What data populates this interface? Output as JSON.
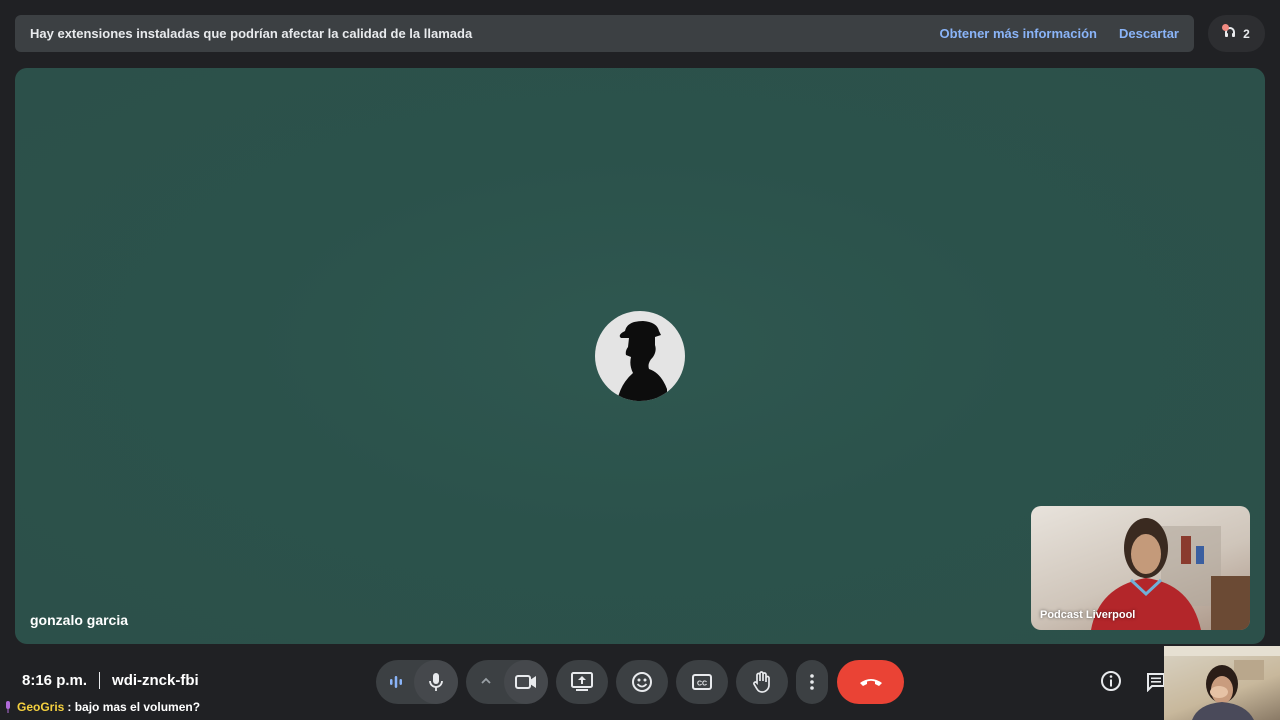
{
  "banner": {
    "message": "Hay extensiones instaladas que podrían afectar la calidad de la llamada",
    "learn_more": "Obtener más información",
    "dismiss": "Descartar"
  },
  "participants": {
    "count": "2"
  },
  "main_tile": {
    "name": "gonzalo garcia"
  },
  "self_tile": {
    "name": "Podcast Liverpool"
  },
  "meeting": {
    "time": "8:16 p.m.",
    "code": "wdi-znck-fbi"
  },
  "chat_overlay": {
    "user": "GeoGris",
    "message": ": bajo mas el volumen?"
  },
  "colors": {
    "hangup": "#ea4335",
    "link": "#8ab4f8",
    "stage": "#2c524b"
  },
  "icons": [
    "speaking-indicator-icon",
    "microphone-icon",
    "chevron-up-icon",
    "camera-icon",
    "present-screen-icon",
    "emoji-icon",
    "captions-icon",
    "raise-hand-icon",
    "more-options-icon",
    "hang-up-icon",
    "info-icon",
    "chat-icon"
  ]
}
